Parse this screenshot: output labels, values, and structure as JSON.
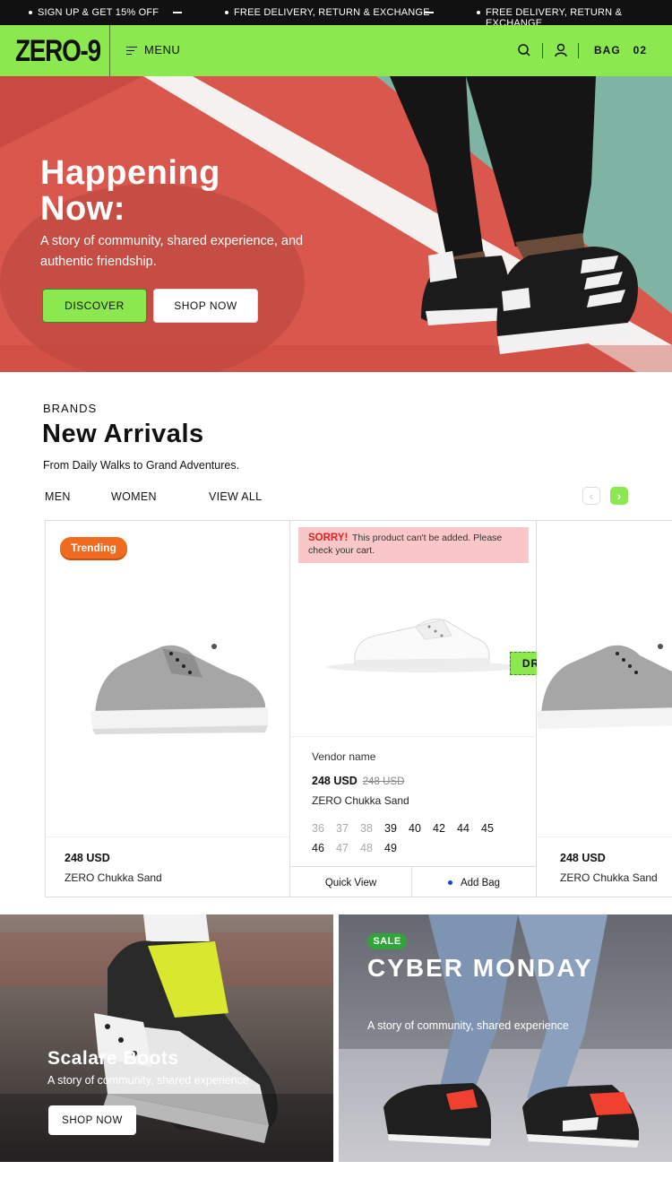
{
  "announcement": {
    "items": [
      "SIGN UP & GET 15% OFF",
      "FREE DELIVERY, RETURN & EXCHANGE",
      "FREE DELIVERY, RETURN & EXCHANGE"
    ]
  },
  "header": {
    "logo": "ZERO-9",
    "menu_label": "MENU",
    "bag_label": "BAG",
    "bag_count": "02",
    "accent_color": "#8be84f"
  },
  "hero": {
    "title": "Happening Now:",
    "subtitle": "A story of community, shared experience, and authentic friendship.",
    "discover_label": "DISCOVER",
    "shop_label": "SHOP NOW"
  },
  "arrivals": {
    "eyebrow": "BRANDS",
    "title": "New Arrivals",
    "subtitle": "From Daily Walks to Grand Adventures.",
    "filters": [
      "MEN",
      "WOMEN",
      "VIEW ALL"
    ],
    "prev_icon": "‹",
    "next_icon": "›"
  },
  "products": [
    {
      "badge": "Trending",
      "price": "248 USD",
      "name": "ZERO Chukka Sand"
    },
    {
      "alert_strong": "SORRY!",
      "alert_text": "This product can't be added. Please check your cart.",
      "drag_label": "DRAG",
      "vendor": "Vendor name",
      "price": "248 USD",
      "old_price": "248 USD",
      "name": "ZERO Chukka Sand",
      "sizes": [
        {
          "label": "36",
          "available": false
        },
        {
          "label": "37",
          "available": false
        },
        {
          "label": "38",
          "available": false
        },
        {
          "label": "39",
          "available": true
        },
        {
          "label": "40",
          "available": true
        },
        {
          "label": "42",
          "available": true
        },
        {
          "label": "44",
          "available": true
        },
        {
          "label": "45",
          "available": true
        },
        {
          "label": "46",
          "available": true
        },
        {
          "label": "47",
          "available": false
        },
        {
          "label": "48",
          "available": false
        },
        {
          "label": "49",
          "available": true
        }
      ],
      "quick_view_label": "Quick View",
      "add_bag_label": "Add Bag"
    },
    {
      "price": "248 USD",
      "name": "ZERO Chukka Sand"
    }
  ],
  "promos": [
    {
      "title": "Scalare Boots",
      "subtitle": "A story of community, shared experience",
      "button_label": "SHOP NOW"
    },
    {
      "badge": "SALE",
      "title": "CYBER MONDAY",
      "subtitle": "A story of community, shared experience"
    }
  ]
}
